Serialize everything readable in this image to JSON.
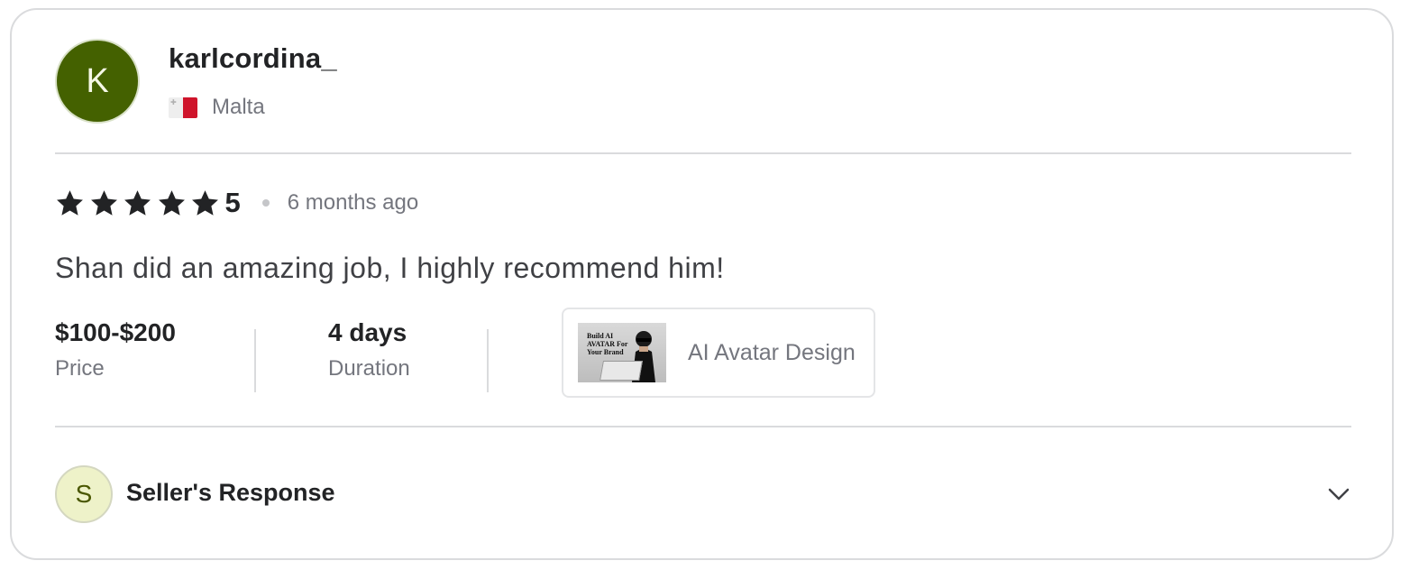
{
  "reviewer": {
    "initial": "K",
    "username": "karlcordina_",
    "country": "Malta",
    "flag_icon": "malta-flag-icon",
    "avatar_color": "#446100"
  },
  "review": {
    "stars": 5,
    "score": "5",
    "time_ago": "6 months ago",
    "text": "Shan did an amazing job, I highly recommend him!"
  },
  "meta": {
    "price_value": "$100-$200",
    "price_label": "Price",
    "duration_value": "4 days",
    "duration_label": "Duration"
  },
  "gig": {
    "title": "AI Avatar Design",
    "thumb_text": "Build AI AVATAR For Your Brand"
  },
  "seller_response": {
    "initial": "S",
    "title": "Seller's Response",
    "toggle_icon": "chevron-down-icon"
  },
  "colors": {
    "star": "#222325",
    "muted_text": "#74767e",
    "border": "#dadbdd"
  }
}
